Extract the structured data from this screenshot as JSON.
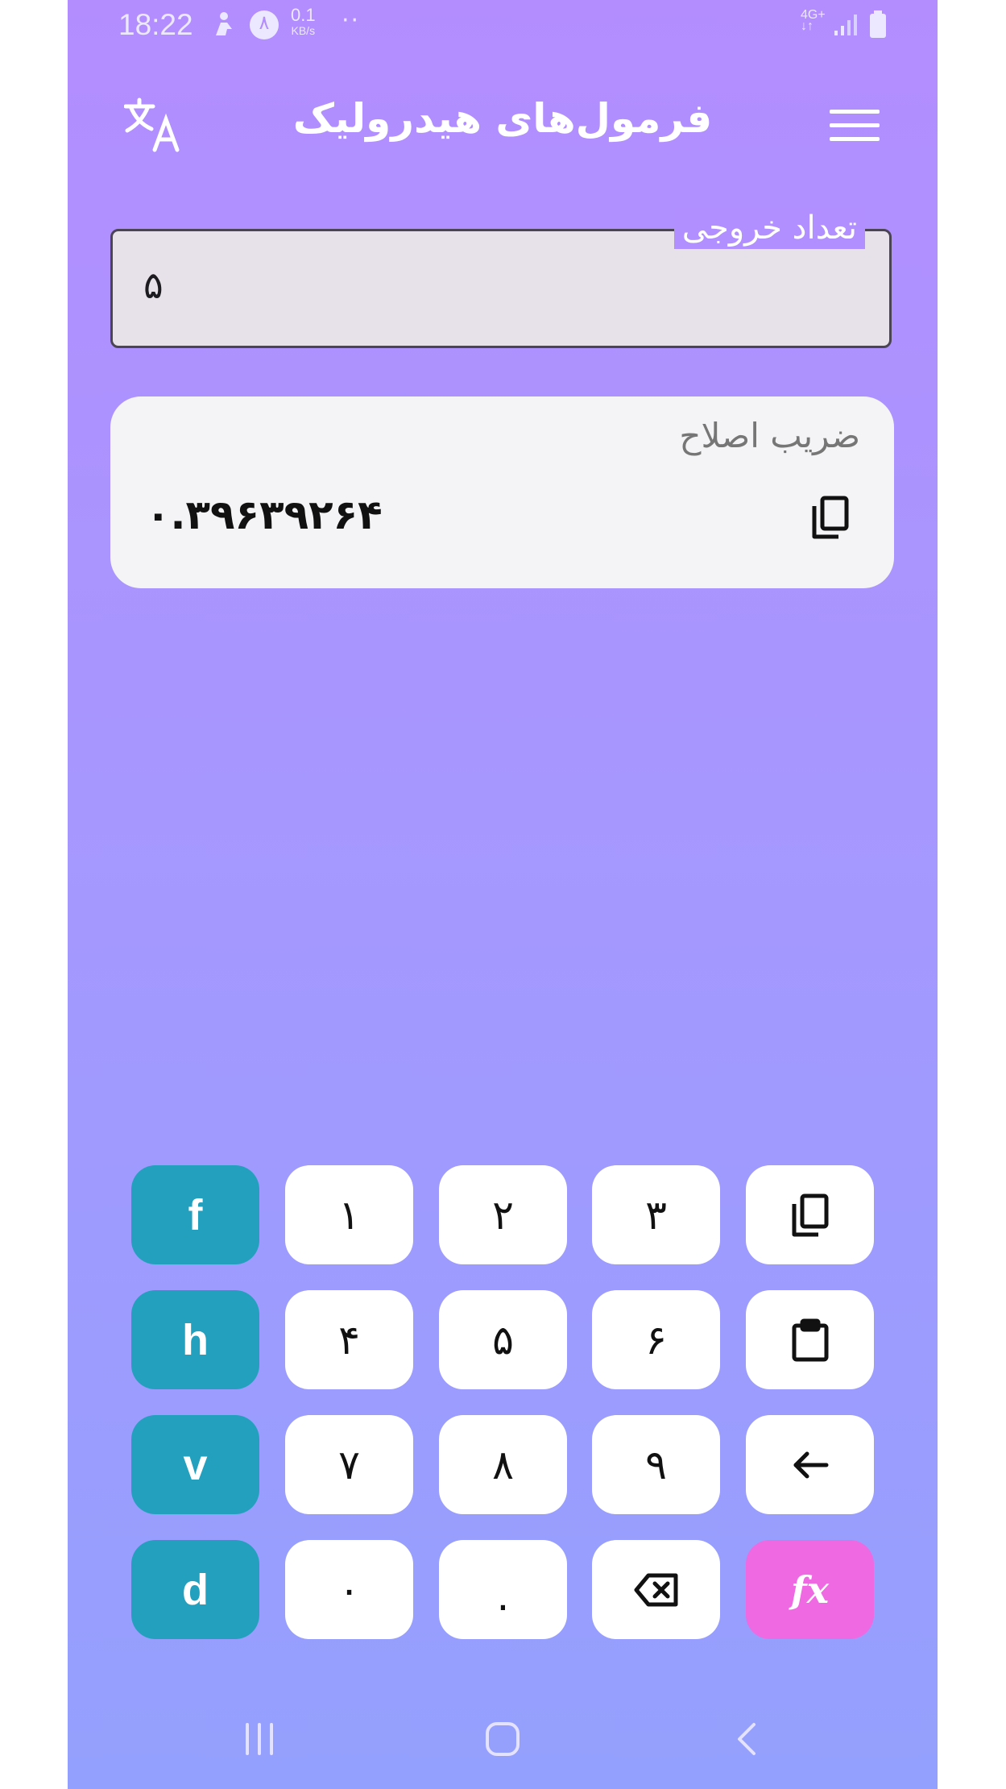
{
  "status_bar": {
    "time": "18:22",
    "notification_badge": "۸",
    "speed_value": "0.1",
    "speed_unit": "KB/s",
    "network_type": "4G+"
  },
  "app_bar": {
    "title": "فرمول‌های هیدرولیک",
    "translate_icon": "translate-icon",
    "menu_icon": "hamburger-menu-icon"
  },
  "input_field": {
    "label": "تعداد خروجی",
    "value": "۵"
  },
  "result": {
    "label": "ضریب اصلاح",
    "value": "۰.۳۹۶۳۹۲۶۴",
    "copy_icon": "copy-icon"
  },
  "keypad": {
    "rows": [
      [
        {
          "label": "f",
          "type": "var"
        },
        {
          "label": "۱",
          "type": "digit"
        },
        {
          "label": "۲",
          "type": "digit"
        },
        {
          "label": "۳",
          "type": "digit"
        },
        {
          "icon": "copy-icon",
          "type": "action"
        }
      ],
      [
        {
          "label": "h",
          "type": "var"
        },
        {
          "label": "۴",
          "type": "digit"
        },
        {
          "label": "۵",
          "type": "digit"
        },
        {
          "label": "۶",
          "type": "digit"
        },
        {
          "icon": "clipboard-paste-icon",
          "type": "action"
        }
      ],
      [
        {
          "label": "v",
          "type": "var"
        },
        {
          "label": "۷",
          "type": "digit"
        },
        {
          "label": "۸",
          "type": "digit"
        },
        {
          "label": "۹",
          "type": "digit"
        },
        {
          "icon": "arrow-left-icon",
          "type": "action"
        }
      ],
      [
        {
          "label": "d",
          "type": "var"
        },
        {
          "label": "۰",
          "type": "digit"
        },
        {
          "label": ".",
          "type": "digit"
        },
        {
          "icon": "backspace-icon",
          "type": "action"
        },
        {
          "label": "fx",
          "type": "fx"
        }
      ]
    ]
  },
  "colors": {
    "gradient_top": "#b38dfe",
    "gradient_bottom": "#94a0fd",
    "variable_key": "#24a0bf",
    "fx_key": "#ef69e3"
  },
  "nav_bar": {
    "icons": [
      "recent-apps-icon",
      "home-icon",
      "back-icon"
    ]
  }
}
